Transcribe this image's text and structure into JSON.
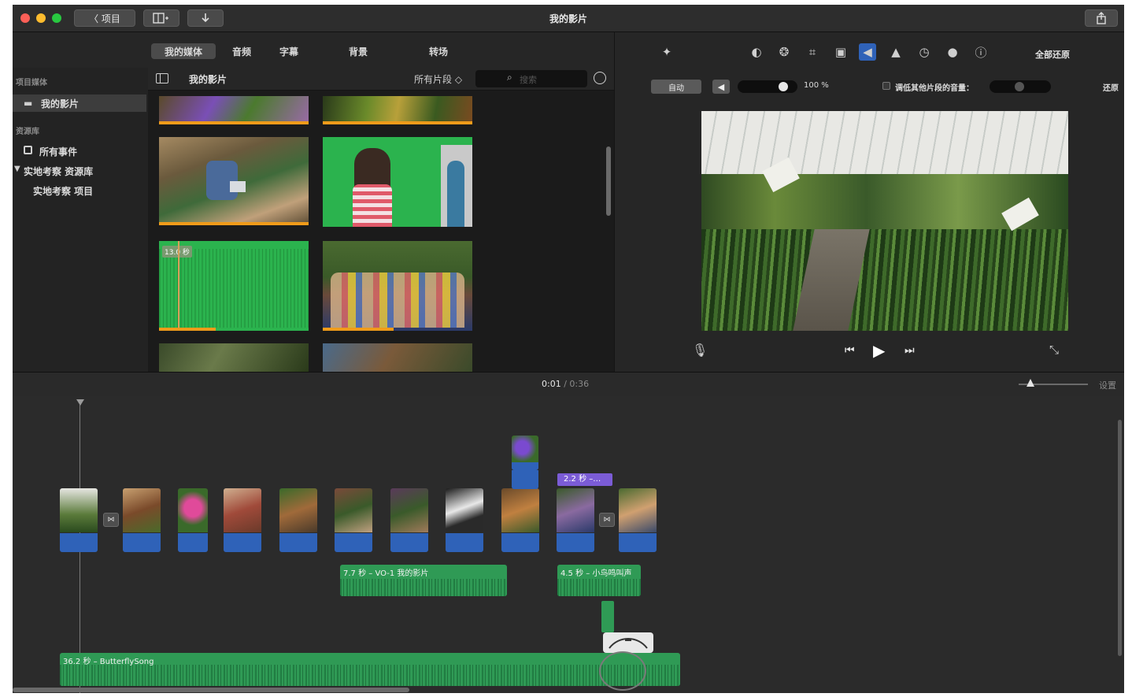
{
  "window": {
    "title": "我的影片",
    "back_label": "〈 项目",
    "share_icon": "share-icon"
  },
  "media_tabs": [
    "我的媒体",
    "音频",
    "字幕",
    "背景",
    "转场"
  ],
  "sidebar": {
    "section_media": "项目媒体",
    "item_movie": "我的影片",
    "section_library": "资源库",
    "item_all_events": "所有事件",
    "item_library": "实地考察 资源库",
    "item_project": "实地考察 项目"
  },
  "browser": {
    "title": "我的影片",
    "filter": "所有片段 ◇",
    "search_placeholder": "搜索",
    "audio_clip_duration": "13.0 秒"
  },
  "viewer": {
    "reset_all": "全部还原",
    "auto_button": "自动",
    "volume": "100 %",
    "duck_label": "调低其他片段的音量：",
    "reset": "还原"
  },
  "timeline": {
    "timecode_current": "0:01",
    "timecode_sep": "/",
    "timecode_total": "0:36",
    "settings": "设置",
    "title_clip": "2.2 秒 –…",
    "voiceover_clip": "7.7 秒 – VO-1 我的影片",
    "sound_clip": "4.5 秒 – 小鸟鸣叫声",
    "music_clip": "36.2 秒 – ButterflySong"
  },
  "colors": {
    "accent_orange": "#f09b1a",
    "audio_green": "#2f9a55",
    "clip_audio_blue": "#2f62b8",
    "title_purple": "#7b5cd6"
  }
}
